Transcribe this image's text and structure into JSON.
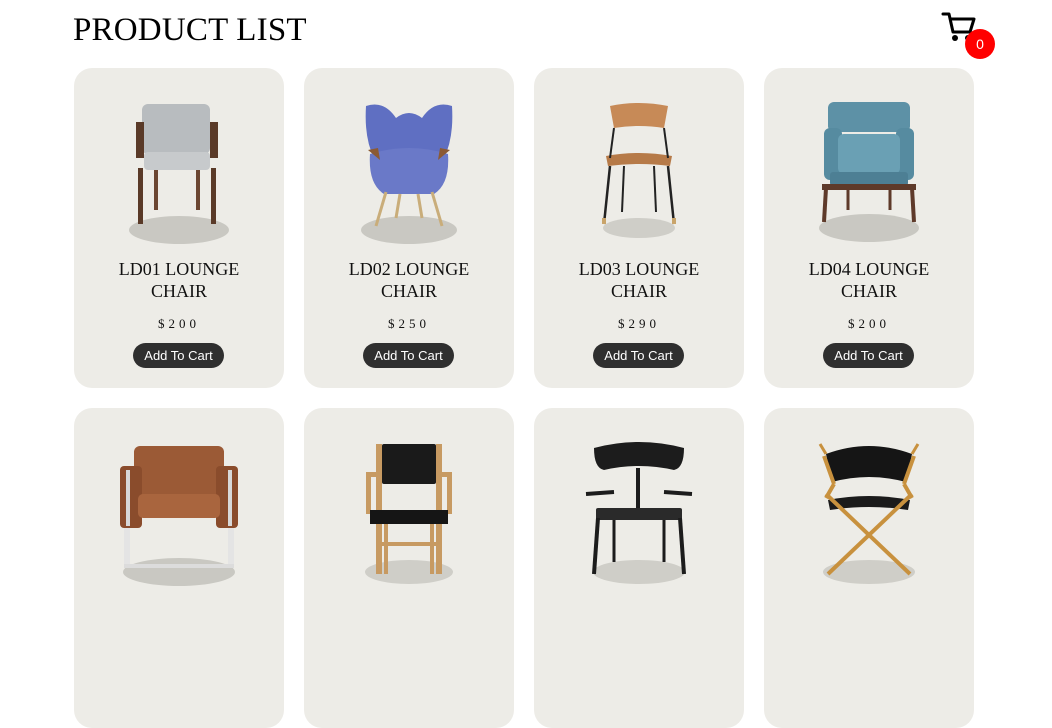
{
  "header": {
    "title": "PRODUCT LIST",
    "cart_icon": "shopping-cart-icon",
    "cart_count": "0",
    "cart_badge_color": "#ff0000"
  },
  "colors": {
    "card_background": "#edece7",
    "button_background": "#2f2f2f",
    "button_text": "#ffffff"
  },
  "products": [
    {
      "name": "LD01 LOUNGE CHAIR",
      "price": "$200",
      "button": "Add To Cart",
      "image": "grey-upholstered-armchair"
    },
    {
      "name": "LD02 LOUNGE CHAIR",
      "price": "$250",
      "button": "Add To Cart",
      "image": "blue-wingback-lounge-chair"
    },
    {
      "name": "LD03 LOUNGE CHAIR",
      "price": "$290",
      "button": "Add To Cart",
      "image": "wooden-shell-chair-black-legs"
    },
    {
      "name": "LD04 LOUNGE CHAIR",
      "price": "$200",
      "button": "Add To Cart",
      "image": "teal-cushioned-armchair"
    },
    {
      "name": "",
      "price": "",
      "button": "",
      "image": "brown-leather-armchair-chrome"
    },
    {
      "name": "",
      "price": "",
      "button": "",
      "image": "black-seat-wooden-frame-chair"
    },
    {
      "name": "",
      "price": "",
      "button": "",
      "image": "black-wood-armchair"
    },
    {
      "name": "",
      "price": "",
      "button": "",
      "image": "black-leather-sawbuck-chair"
    }
  ]
}
